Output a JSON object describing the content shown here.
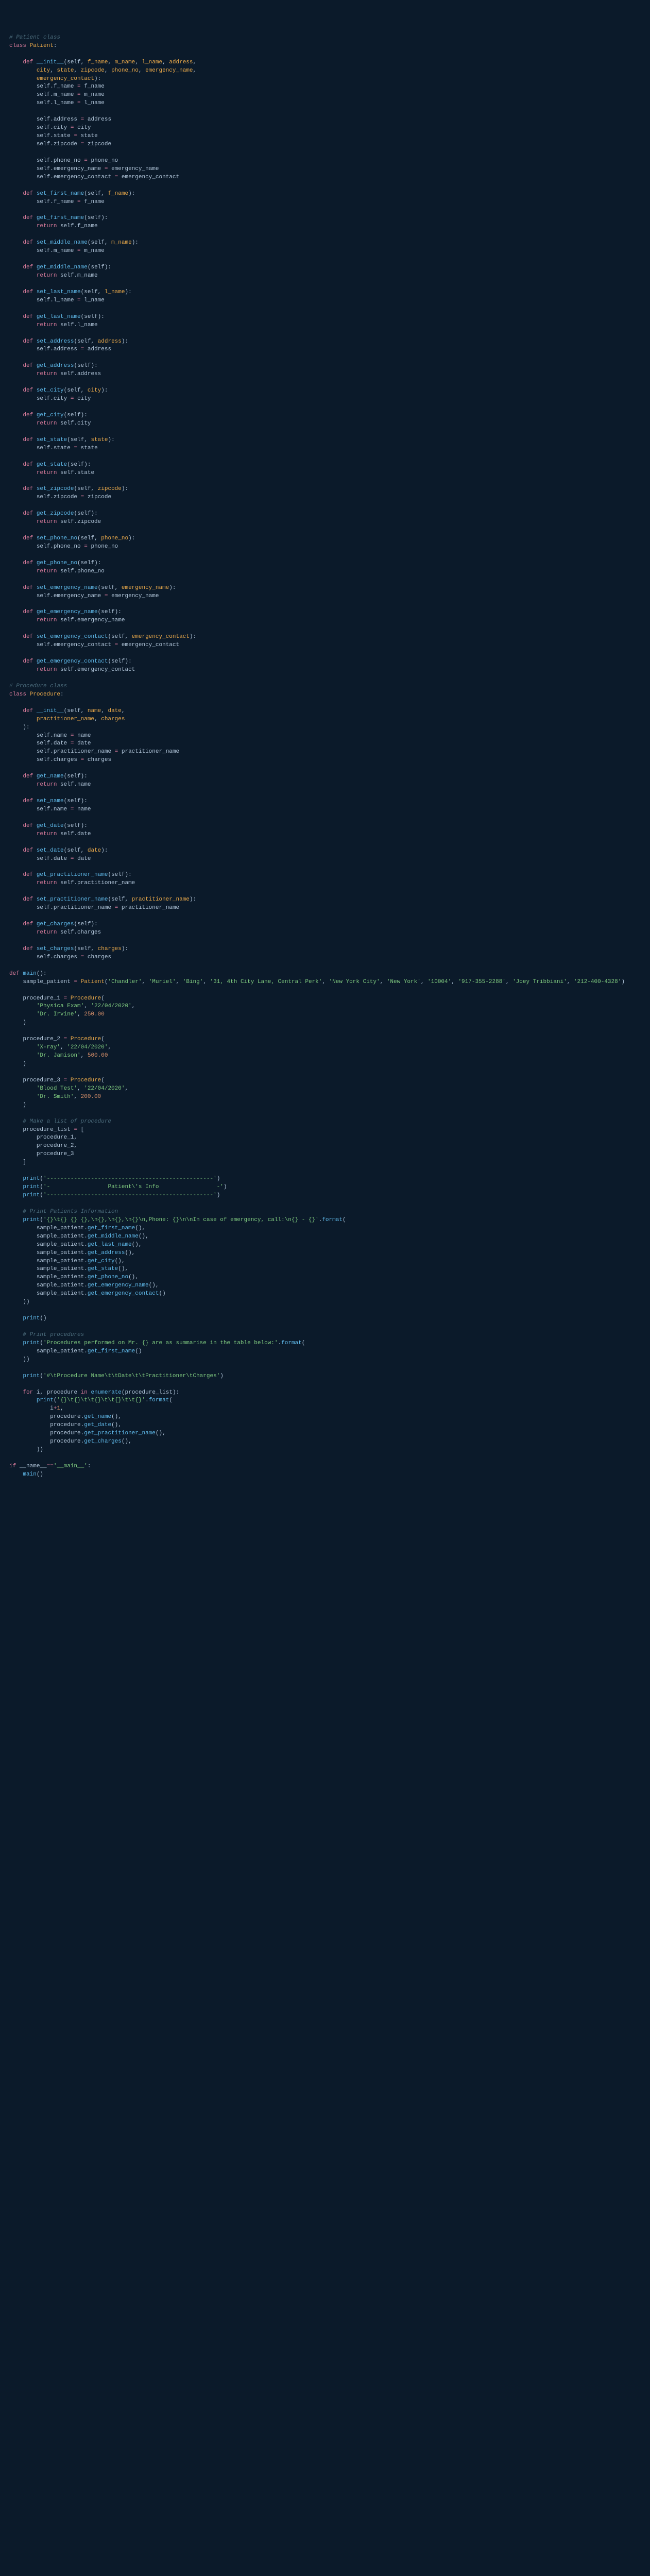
{
  "code": {
    "comments": {
      "patient_class": "# Patient class",
      "procedure_class": "# Procedure class",
      "make_list": "# Make a list of procedure",
      "print_patients": "# Print Patients Information",
      "print_procedures": "# Print procedures"
    },
    "keywords": {
      "class": "class",
      "def": "def",
      "return": "return",
      "for": "for",
      "in": "in",
      "if": "if"
    },
    "classes": {
      "Patient": "Patient",
      "Procedure": "Procedure"
    },
    "methods": {
      "init": "__init__",
      "set_first_name": "set_first_name",
      "get_first_name": "get_first_name",
      "set_middle_name": "set_middle_name",
      "get_middle_name": "get_middle_name",
      "set_last_name": "set_last_name",
      "get_last_name": "get_last_name",
      "set_address": "set_address",
      "get_address": "get_address",
      "set_city": "set_city",
      "get_city": "get_city",
      "set_state": "set_state",
      "get_state": "get_state",
      "set_zipcode": "set_zipcode",
      "get_zipcode": "get_zipcode",
      "set_phone_no": "set_phone_no",
      "get_phone_no": "get_phone_no",
      "set_emergency_name": "set_emergency_name",
      "get_emergency_name": "get_emergency_name",
      "set_emergency_contact": "set_emergency_contact",
      "get_emergency_contact": "get_emergency_contact",
      "get_name": "get_name",
      "set_name": "set_name",
      "get_date": "get_date",
      "set_date": "set_date",
      "get_practitioner_name": "get_practitioner_name",
      "set_practitioner_name": "set_practitioner_name",
      "get_charges": "get_charges",
      "set_charges": "set_charges",
      "main": "main",
      "enumerate": "enumerate",
      "print": "print",
      "format": "format"
    },
    "params": {
      "self": "self",
      "f_name": "f_name",
      "m_name": "m_name",
      "l_name": "l_name",
      "address": "address",
      "city": "city",
      "state": "state",
      "zipcode": "zipcode",
      "phone_no": "phone_no",
      "emergency_name": "emergency_name",
      "emergency_contact": "emergency_contact",
      "name": "name",
      "date": "date",
      "practitioner_name": "practitioner_name",
      "charges": "charges",
      "i": "i",
      "procedure": "procedure"
    },
    "vars": {
      "sample_patient": "sample_patient",
      "procedure_1": "procedure_1",
      "procedure_2": "procedure_2",
      "procedure_3": "procedure_3",
      "procedure_list": "procedure_list"
    },
    "strings": {
      "chandler": "'Chandler'",
      "muriel": "'Muriel'",
      "bing": "'Bing'",
      "address": "'31, 4th City Lane, Central Perk'",
      "nyc": "'New York City'",
      "ny": "'New York'",
      "zip": "'10004'",
      "phone1": "'917-355-2288'",
      "joey": "'Joey Tribbiani'",
      "phone2": "'212-400-4328'",
      "physica": "'Physica Exam'",
      "date1": "'22/04/2020'",
      "irvine": "'Dr. Irvine'",
      "xray": "'X-ray'",
      "jamison": "'Dr. Jamison'",
      "blood": "'Blood Test'",
      "smith": "'Dr. Smith'",
      "dashes": "'-------------------------------------------------'",
      "title_info": "'-                 Patient\\'s Info                 -'",
      "patient_fmt": "'{}\\t{} {} {},\\n{},\\n{},\\n{}\\n,Phone: {}\\n\\nIn case of emergency, call:\\n{} - {}'",
      "procedures_header": "'Procedures performed on Mr. {} are as summarise in the table below:'",
      "table_header": "'#\\tProcedure Name\\t\\tDate\\t\\tPractitioner\\tCharges'",
      "row_fmt": "'{}\\t{}\\t\\t{}\\t\\t{}\\t\\t{}'",
      "name_main": "'__main__'"
    },
    "numbers": {
      "n250": "250.00",
      "n500": "500.00",
      "n200": "200.00",
      "n1": "1"
    },
    "dunder": {
      "name": "__name__"
    }
  }
}
